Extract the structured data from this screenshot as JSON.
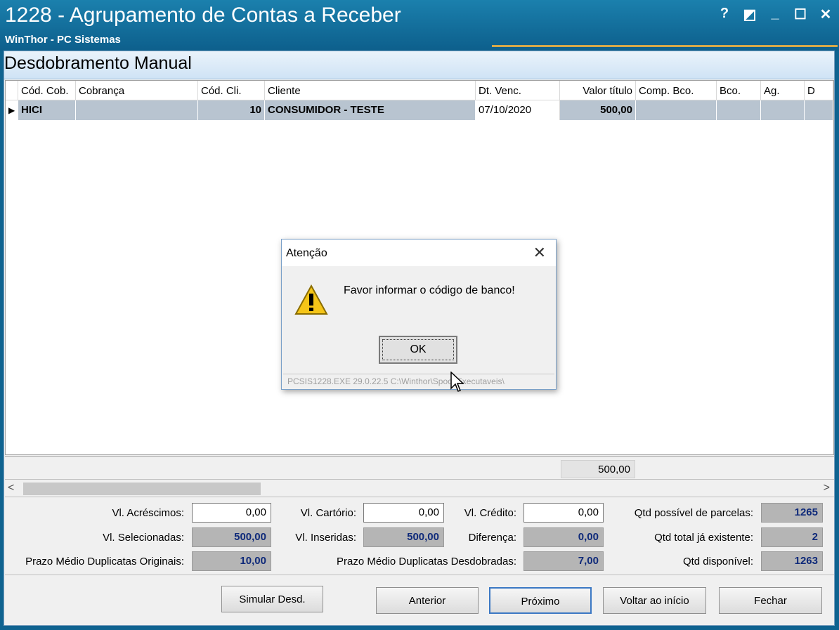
{
  "window": {
    "title": "1228 - Agrupamento de Contas a Receber",
    "subtitle": "WinThor - PC Sistemas",
    "controls": [
      "?",
      "◩",
      "_",
      "☐",
      "✕"
    ]
  },
  "page": {
    "header": "Desdobramento Manual"
  },
  "grid": {
    "columns": [
      "Cód. Cob.",
      "Cobrança",
      "Cód. Cli.",
      "Cliente",
      "Dt. Venc.",
      "Valor título",
      "Comp. Bco.",
      "Bco.",
      "Ag.",
      "D"
    ],
    "row": {
      "cod_cob": "HICI",
      "cobranca": "",
      "cod_cli": "10",
      "cliente": "CONSUMIDOR - TESTE",
      "dt_venc": "07/10/2020",
      "valor_titulo": "500,00",
      "comp_bco": "",
      "bco": "",
      "ag": "",
      "d": ""
    },
    "footer_total": "500,00"
  },
  "summary": {
    "vl_acrescimos_label": "Vl. Acréscimos:",
    "vl_acrescimos": "0,00",
    "vl_cartorio_label": "Vl. Cartório:",
    "vl_cartorio": "0,00",
    "vl_credito_label": "Vl. Crédito:",
    "vl_credito": "0,00",
    "qtd_possivel_label": "Qtd possível de parcelas:",
    "qtd_possivel": "1265",
    "vl_selecionadas_label": "Vl. Selecionadas:",
    "vl_selecionadas": "500,00",
    "vl_inseridas_label": "Vl. Inseridas:",
    "vl_inseridas": "500,00",
    "diferenca_label": "Diferença:",
    "diferenca": "0,00",
    "qtd_total_label": "Qtd total já existente:",
    "qtd_total": "2",
    "prazo_orig_label": "Prazo Médio Duplicatas Originais:",
    "prazo_orig": "10,00",
    "prazo_desd_label": "Prazo Médio Duplicatas Desdobradas:",
    "prazo_desd": "7,00",
    "qtd_disp_label": "Qtd disponível:",
    "qtd_disp": "1263"
  },
  "buttons": {
    "simular": "Simular Desd.",
    "anterior": "Anterior",
    "proximo": "Próximo",
    "voltar": "Voltar ao início",
    "fechar": "Fechar"
  },
  "dialog": {
    "title": "Atenção",
    "message": "Favor informar o código de banco!",
    "ok": "OK",
    "status": "PCSIS1228.EXE 29.0.22.5  C:\\Winthor\\Spool\\Executaveis\\"
  },
  "colors": {
    "titlebar": "#0f6390",
    "readonly_field": "#b5b5b5",
    "readonly_text": "#0f2a7a",
    "selected_row": "#b8c4d0"
  }
}
